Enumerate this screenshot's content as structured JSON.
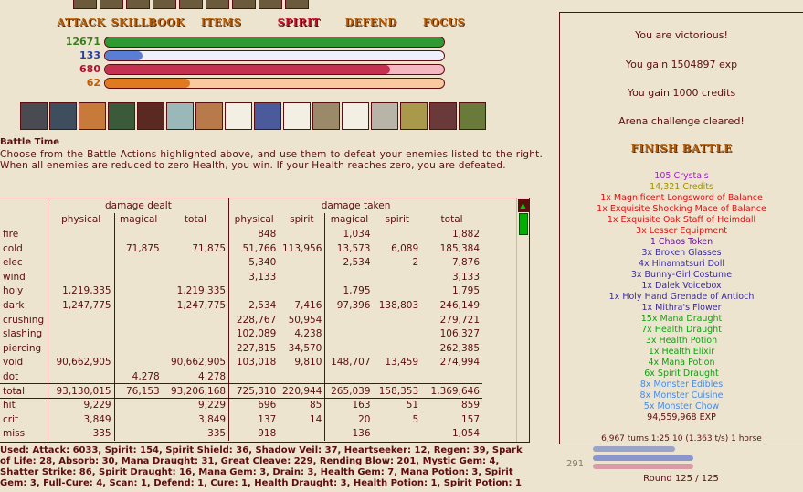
{
  "menu": [
    "ATTACK",
    "SKILLBOOK",
    "ITEMS",
    "SPIRIT",
    "DEFEND",
    "FOCUS"
  ],
  "menu_active_index": 3,
  "bars": [
    {
      "value": "12671",
      "text_color": "#3d7d1f",
      "fill_color": "#2f9a33",
      "track_color": "#2f9a33",
      "fill_fraction": 1.0
    },
    {
      "value": "133",
      "text_color": "#2b3ea6",
      "fill_color": "#5a7ed6",
      "track_color": "#eef0fb",
      "fill_fraction": 0.11
    },
    {
      "value": "680",
      "text_color": "#b01030",
      "fill_color": "#c4304f",
      "track_color": "#f5b8c2",
      "fill_fraction": 0.84
    },
    {
      "value": "62",
      "text_color": "#c25a00",
      "fill_color": "#e07a20",
      "track_color": "#f9c9a0",
      "fill_fraction": 0.25
    }
  ],
  "battle": {
    "title": "Battle Time",
    "description": "Choose from the Battle Actions highlighted above, and use them to defeat your enemies listed to the right. When all enemies are reduced to zero Health, you win. If your Health reaches zero, you are defeated."
  },
  "stats": {
    "group_headers": [
      "damage dealt",
      "damage taken"
    ],
    "col_headers": [
      "physical",
      "magical",
      "total",
      "physical",
      "spirit",
      "magical",
      "spirit",
      "total"
    ],
    "rows": [
      [
        "fire",
        "",
        "",
        "",
        "848",
        "",
        "1,034",
        "",
        "1,882"
      ],
      [
        "cold",
        "",
        "71,875",
        "71,875",
        "51,766",
        "113,956",
        "13,573",
        "6,089",
        "185,384"
      ],
      [
        "elec",
        "",
        "",
        "",
        "5,340",
        "",
        "2,534",
        "2",
        "7,876"
      ],
      [
        "wind",
        "",
        "",
        "",
        "3,133",
        "",
        "",
        "",
        "3,133"
      ],
      [
        "holy",
        "1,219,335",
        "",
        "1,219,335",
        "",
        "",
        "1,795",
        "",
        "1,795"
      ],
      [
        "dark",
        "1,247,775",
        "",
        "1,247,775",
        "2,534",
        "7,416",
        "97,396",
        "138,803",
        "246,149"
      ],
      [
        "crushing",
        "",
        "",
        "",
        "228,767",
        "50,954",
        "",
        "",
        "279,721"
      ],
      [
        "slashing",
        "",
        "",
        "",
        "102,089",
        "4,238",
        "",
        "",
        "106,327"
      ],
      [
        "piercing",
        "",
        "",
        "",
        "227,815",
        "34,570",
        "",
        "",
        "262,385"
      ],
      [
        "void",
        "90,662,905",
        "",
        "90,662,905",
        "103,018",
        "9,810",
        "148,707",
        "13,459",
        "274,994"
      ],
      [
        "dot",
        "",
        "4,278",
        "4,278",
        "",
        "",
        "",
        "",
        ""
      ],
      [
        "total",
        "93,130,015",
        "76,153",
        "93,206,168",
        "725,310",
        "220,944",
        "265,039",
        "158,353",
        "1,369,646"
      ],
      [
        "hit",
        "9,229",
        "",
        "9,229",
        "696",
        "85",
        "163",
        "51",
        "859"
      ],
      [
        "crit",
        "3,849",
        "",
        "3,849",
        "137",
        "14",
        "20",
        "5",
        "157"
      ],
      [
        "miss",
        "335",
        "",
        "335",
        "918",
        "",
        "136",
        "",
        "1,054"
      ]
    ],
    "used": "Used: Attack: 6033, Spirit: 154, Spirit Shield: 36, Shadow Veil: 37, Heartseeker: 12, Regen: 39, Spark of Life: 28, Absorb: 30, Mana Draught: 31, Great Cleave: 229, Rending Blow: 201, Mystic Gem: 4, Shatter Strike: 86, Spirit Draught: 16, Mana Gem: 3, Drain: 3, Health Gem: 7, Mana Potion: 3, Spirit Gem: 3, Full-Cure: 4, Scan: 1, Defend: 1, Cure: 1, Health Draught: 3, Health Potion: 1, Spirit Potion: 1"
  },
  "log": {
    "victory": "You are victorious!",
    "exp": "You gain 1504897 exp",
    "credits": "You gain 1000 credits",
    "arena": "Arena challenge cleared!",
    "finish": "FINISH BATTLE",
    "loot": [
      {
        "text": "105 Crystals",
        "color": "#a020c0"
      },
      {
        "text": "14,321 Credits",
        "color": "#a09000"
      },
      {
        "text": "1x Magnificent Longsword of Balance",
        "color": "#e01010"
      },
      {
        "text": "1x Exquisite Shocking Mace of Balance",
        "color": "#e01010"
      },
      {
        "text": "1x Exquisite Oak Staff of Heimdall",
        "color": "#e01010"
      },
      {
        "text": "3x Lesser Equipment",
        "color": "#e01010"
      },
      {
        "text": "1 Chaos Token",
        "color": "#6a1590"
      },
      {
        "text": "3x Broken Glasses",
        "color": "#3a2a9a"
      },
      {
        "text": "4x Hinamatsuri Doll",
        "color": "#3a2a9a"
      },
      {
        "text": "3x Bunny-Girl Costume",
        "color": "#3a2a9a"
      },
      {
        "text": "1x Dalek Voicebox",
        "color": "#3a2a9a"
      },
      {
        "text": "1x Holy Hand Grenade of Antioch",
        "color": "#3a2a9a"
      },
      {
        "text": "1x Mithra's Flower",
        "color": "#3a2a9a"
      },
      {
        "text": "15x Mana Draught",
        "color": "#10a010"
      },
      {
        "text": "7x Health Draught",
        "color": "#10a010"
      },
      {
        "text": "3x Health Potion",
        "color": "#10a010"
      },
      {
        "text": "1x Health Elixir",
        "color": "#10a010"
      },
      {
        "text": "4x Mana Potion",
        "color": "#10a010"
      },
      {
        "text": "6x Spirit Draught",
        "color": "#10a010"
      },
      {
        "text": "8x Monster Edibles",
        "color": "#4a8ae0"
      },
      {
        "text": "8x Monster Cuisine",
        "color": "#4a8ae0"
      },
      {
        "text": "5x Monster Chow",
        "color": "#4a8ae0"
      },
      {
        "text": "94,559,968 EXP",
        "color": "#5c0d11"
      }
    ],
    "turns": "6,967 turns 1:25:10 (1.363 t/s) 1 horse"
  },
  "player": {
    "hp_value": "291",
    "round": "Round 125 / 125"
  }
}
